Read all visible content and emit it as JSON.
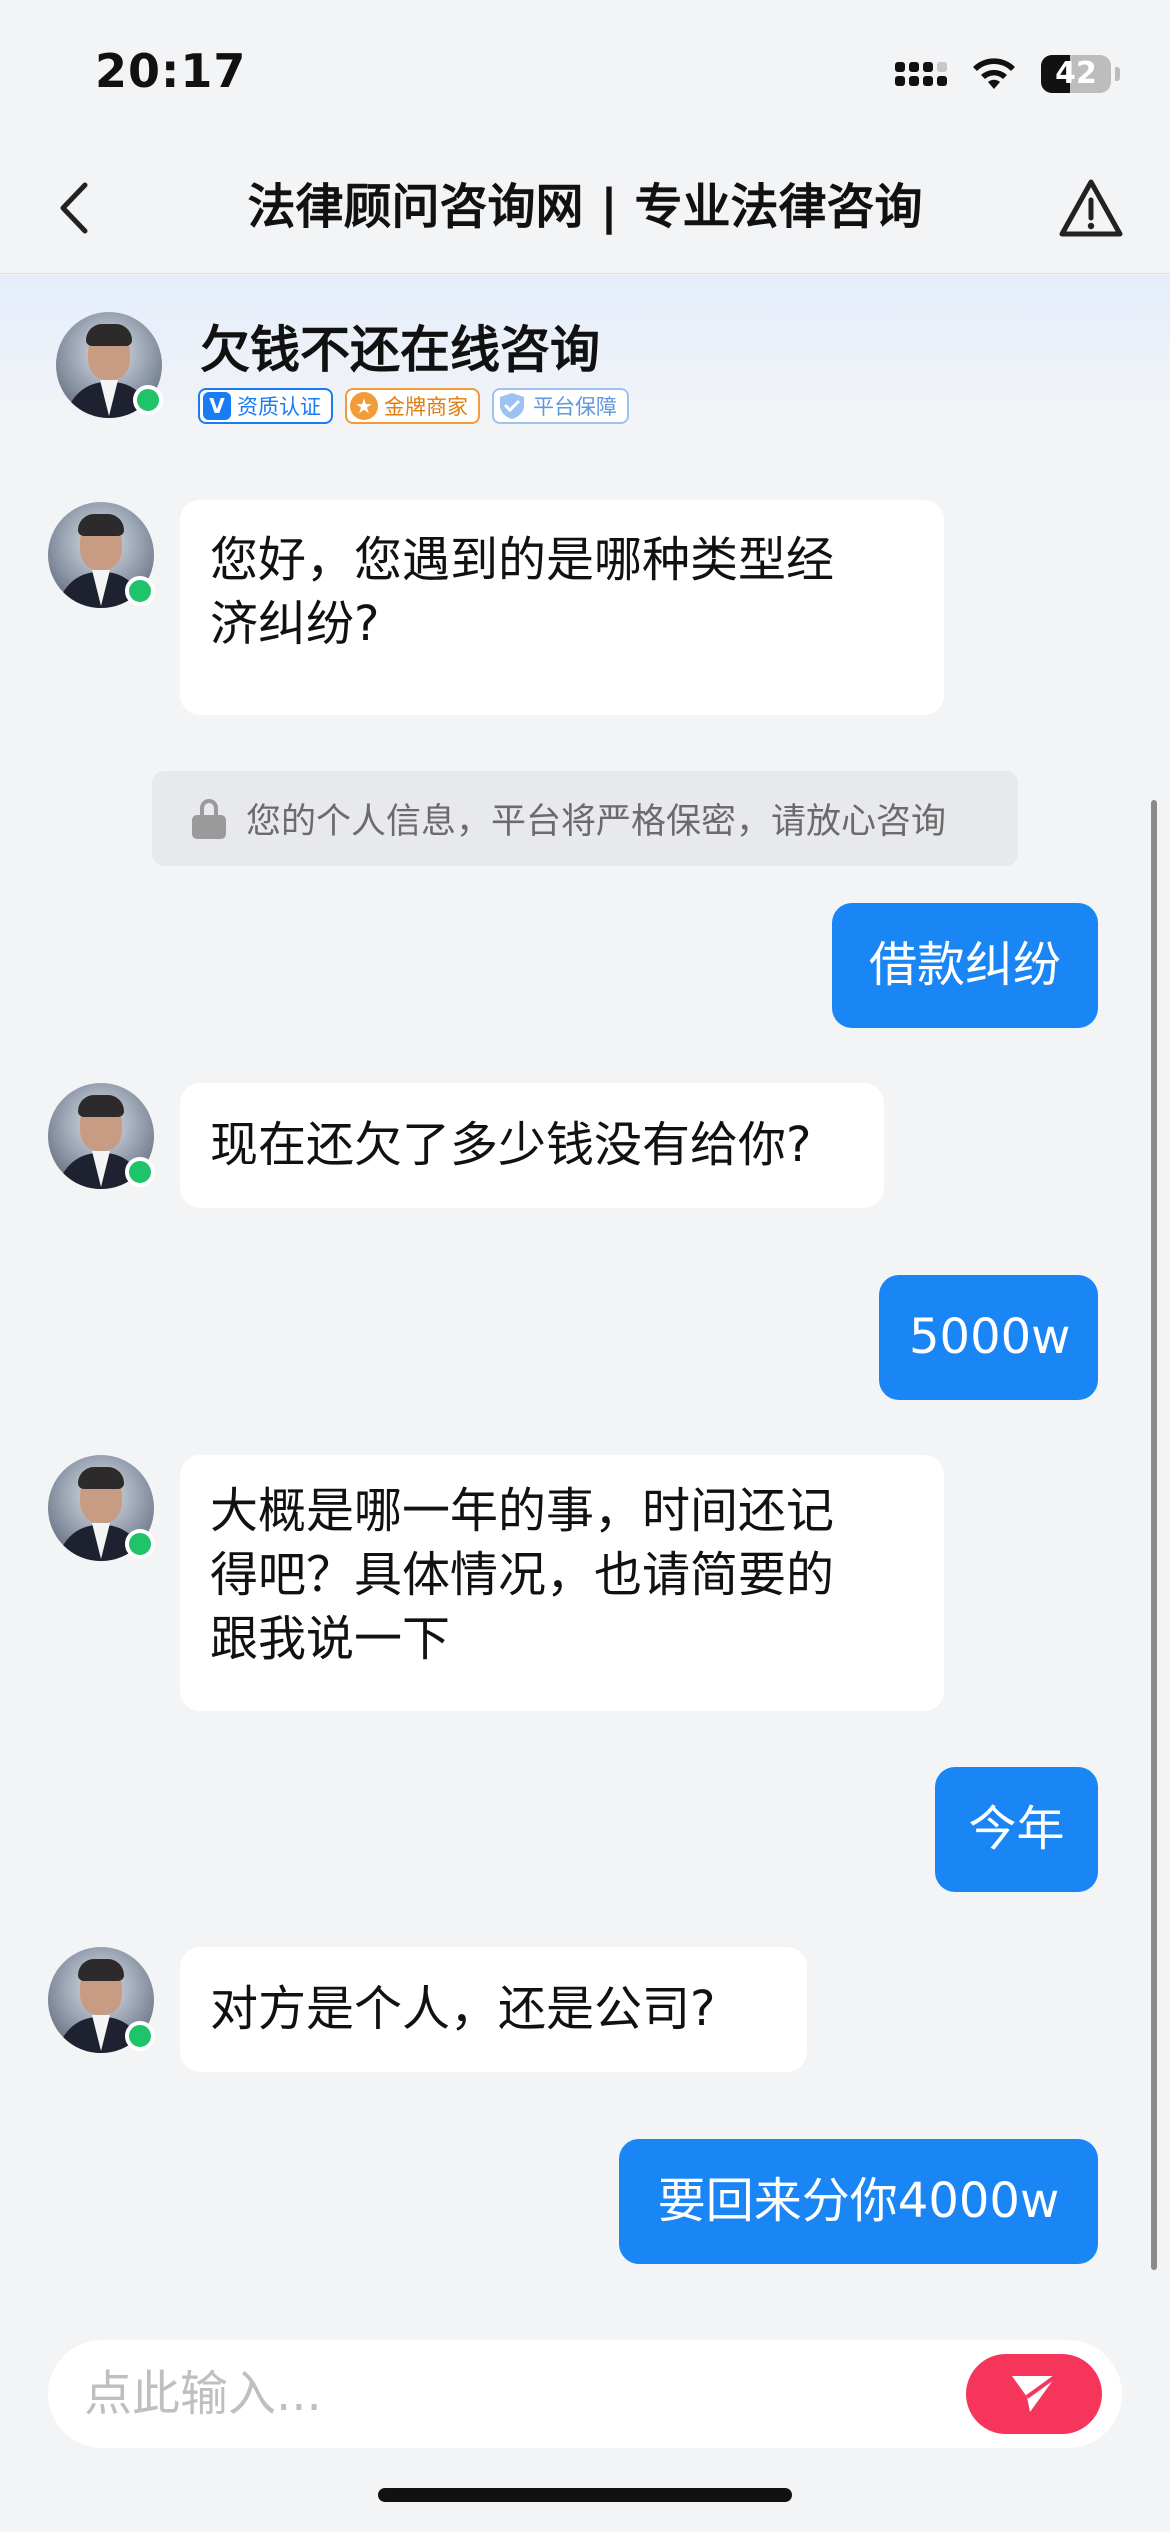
{
  "status_bar": {
    "time": "20:17",
    "battery": "42",
    "battery_level": 0.42
  },
  "nav": {
    "title": "法律顾问咨询网 | 专业法律咨询"
  },
  "lawyer": {
    "name": "欠钱不还在线咨询",
    "badges": [
      {
        "icon": "V",
        "label": "资质认证",
        "color": "#1a7cf5"
      },
      {
        "icon": "★",
        "label": "金牌商家",
        "color": "#f29b39"
      },
      {
        "icon": "shield-check-icon",
        "label": "平台保障",
        "color": "#9cc2f3"
      }
    ]
  },
  "chat": {
    "messages": [
      {
        "from": "lawyer",
        "lines": [
          "您好，您遇到的是哪种类型经",
          "济纠纷?"
        ]
      },
      {
        "from": "system",
        "text": "您的个人信息，平台将严格保密，请放心咨询"
      },
      {
        "from": "user",
        "text": "借款纠纷"
      },
      {
        "from": "lawyer",
        "lines": [
          "现在还欠了多少钱没有给你?"
        ]
      },
      {
        "from": "user",
        "text": "5000w"
      },
      {
        "from": "lawyer",
        "lines": [
          "大概是哪一年的事，时间还记",
          "得吧？具体情况，也请简要的",
          "跟我说一下"
        ]
      },
      {
        "from": "user",
        "text": "今年"
      },
      {
        "from": "lawyer",
        "lines": [
          "对方是个人，还是公司?"
        ]
      },
      {
        "from": "user",
        "text": "要回来分你4000w"
      }
    ]
  },
  "input": {
    "placeholder": "点此输入...",
    "value": ""
  },
  "colors": {
    "accent": "#1a86f6",
    "send": "#f5355a",
    "online": "#1fc36a"
  }
}
